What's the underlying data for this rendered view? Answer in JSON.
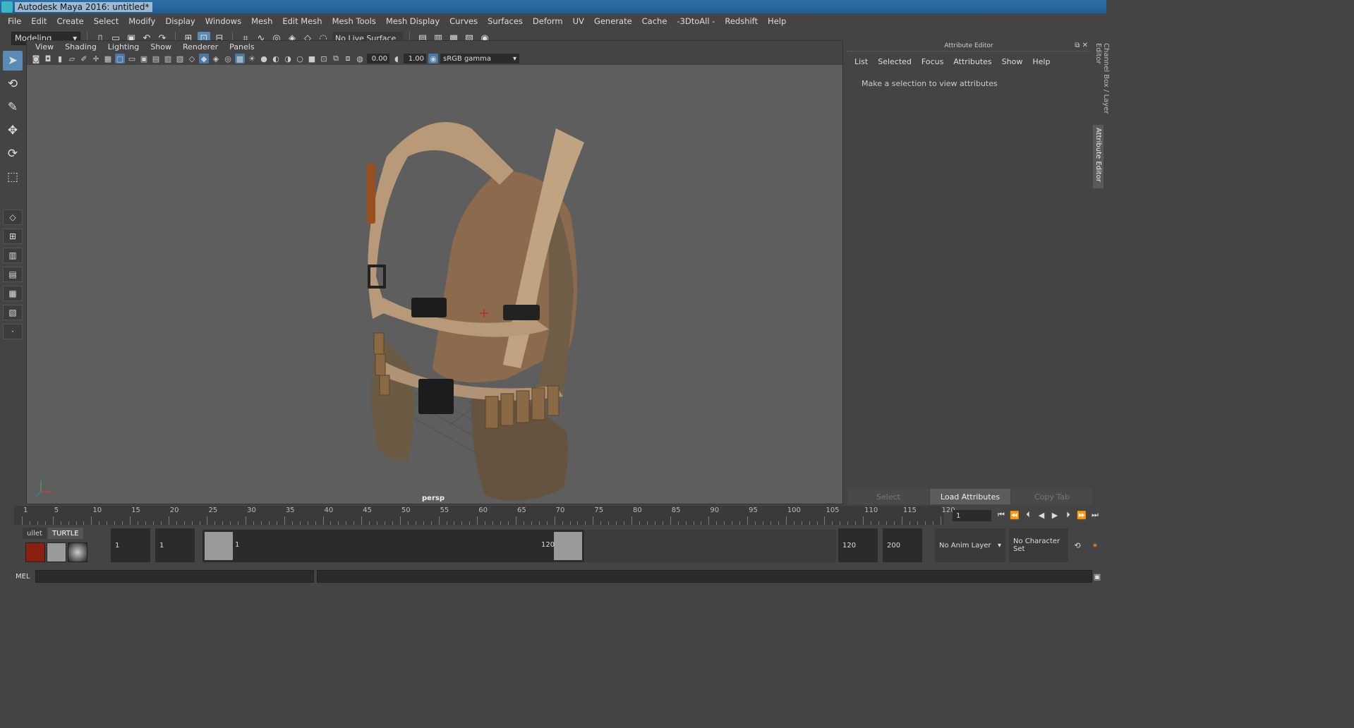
{
  "window": {
    "title": "Autodesk Maya 2016: untitled*"
  },
  "menubar": {
    "items": [
      "File",
      "Edit",
      "Create",
      "Select",
      "Modify",
      "Display",
      "Windows",
      "Mesh",
      "Edit Mesh",
      "Mesh Tools",
      "Mesh Display",
      "Curves",
      "Surfaces",
      "Deform",
      "UV",
      "Generate",
      "Cache",
      "-3DtoAll -",
      "Redshift",
      "Help"
    ]
  },
  "toolbar": {
    "mode": "Modeling",
    "live_surface": "No Live Surface"
  },
  "viewport": {
    "menu": [
      "View",
      "Shading",
      "Lighting",
      "Show",
      "Renderer",
      "Panels"
    ],
    "exposure": "0.00",
    "gamma": "1.00",
    "color_space": "sRGB gamma",
    "camera_label": "persp"
  },
  "attribute_editor": {
    "header": "Attribute Editor",
    "menu": [
      "List",
      "Selected",
      "Focus",
      "Attributes",
      "Show",
      "Help"
    ],
    "message": "Make a selection to view attributes",
    "buttons": {
      "select": "Select",
      "load": "Load Attributes",
      "copy": "Copy Tab"
    }
  },
  "side_tabs": {
    "channel_box": "Channel Box / Layer Editor",
    "attribute_editor": "Attribute Editor"
  },
  "timeslider": {
    "ticks": [
      1,
      5,
      10,
      15,
      20,
      25,
      30,
      35,
      40,
      45,
      50,
      55,
      60,
      65,
      70,
      75,
      80,
      85,
      90,
      95,
      100,
      105,
      110,
      115,
      120
    ],
    "current_frame": "1"
  },
  "shelf": {
    "tabs": [
      "ullet",
      "TURTLE"
    ]
  },
  "range": {
    "start": "1",
    "playback_start": "1",
    "slider_start": "1",
    "slider_end": "120",
    "playback_end": "120",
    "end": "200",
    "anim_layer": "No Anim Layer",
    "character_set": "No Character Set"
  },
  "cmdline": {
    "label": "MEL"
  }
}
